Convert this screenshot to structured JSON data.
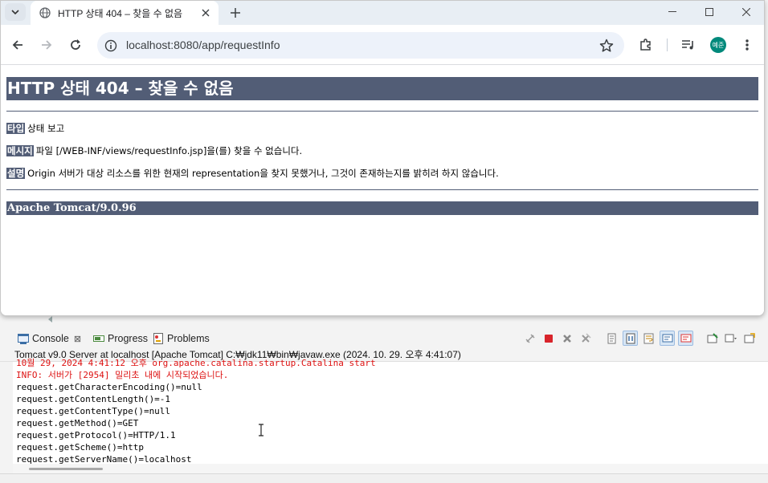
{
  "browser": {
    "tab": {
      "title": "HTTP 상태 404 – 찾을 수 없음"
    },
    "address": {
      "url": "localhost:8080/app/requestInfo"
    },
    "profile": {
      "initials": "예준",
      "color": "#00897b"
    }
  },
  "page": {
    "heading": "HTTP 상태 404 – 찾을 수 없음",
    "type_label": "타입",
    "type_value": "상태 보고",
    "message_label": "메시지",
    "message_value": "파일 [/WEB-INF/views/requestInfo.jsp]을(를) 찾을 수 없습니다.",
    "desc_label": "설명",
    "desc_value": "Origin 서버가 대상 리소스를 위한 현재의 representation을 찾지 못했거나, 그것이 존재하는지를 밝히려 하지 않습니다.",
    "server": "Apache Tomcat/9.0.96",
    "accent": "#525d76"
  },
  "console": {
    "tabs": [
      {
        "label": "Console",
        "icon": "console-icon"
      },
      {
        "label": "Progress",
        "icon": "progress-icon"
      },
      {
        "label": "Problems",
        "icon": "problems-icon"
      }
    ],
    "description": "Tomcat v9.0 Server at localhost [Apache Tomcat] C:₩jdk11₩bin₩javaw.exe  (2024. 10. 29. 오후 4:41:07)",
    "lines": [
      {
        "text": "10월 29, 2024 4:41:12 오후 org.apache.catalina.startup.Catalina start",
        "err": true
      },
      {
        "text": "INFO: 서버가 [2954] 밀리초 내에 시작되었습니다.",
        "err": true
      },
      {
        "text": "request.getCharacterEncoding()=null",
        "err": false
      },
      {
        "text": "request.getContentLength()=-1",
        "err": false
      },
      {
        "text": "request.getContentType()=null",
        "err": false
      },
      {
        "text": "request.getMethod()=GET",
        "err": false
      },
      {
        "text": "request.getProtocol()=HTTP/1.1",
        "err": false
      },
      {
        "text": "request.getScheme()=http",
        "err": false
      },
      {
        "text": "request.getServerName()=localhost",
        "err": false
      }
    ]
  }
}
